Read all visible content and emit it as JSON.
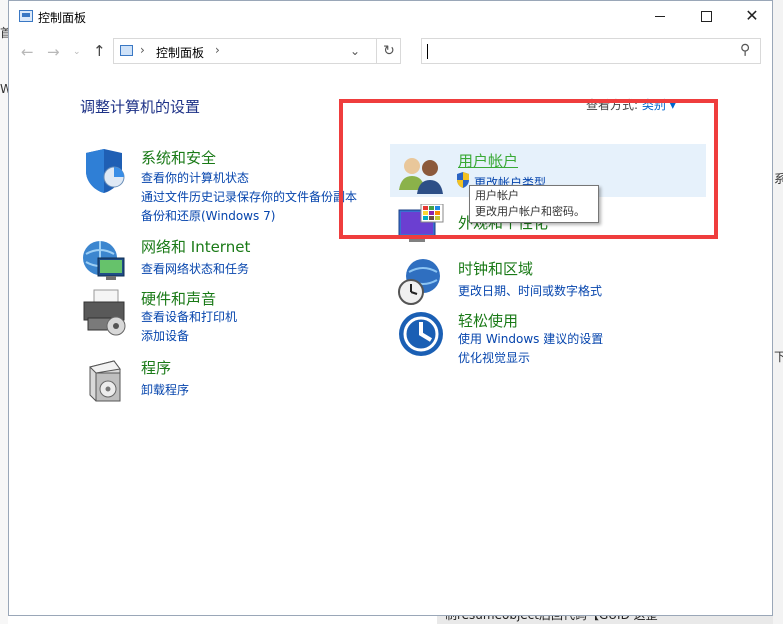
{
  "window": {
    "title": "控制面板",
    "close_glyph": "✕"
  },
  "nav": {
    "back": "←",
    "forward": "→",
    "recent": "⌄",
    "up": "↑",
    "separator": "›",
    "breadcrumb": "控制面板",
    "address_dropdown": "⌄",
    "refresh": "↻",
    "search_value": "",
    "search_glyph": "⚲"
  },
  "heading": "调整计算机的设置",
  "view_by": {
    "label": "查看方式:",
    "value": "类别",
    "arrow": "▾"
  },
  "categories": {
    "system": {
      "title": "系统和安全",
      "links": [
        "查看你的计算机状态",
        "通过文件历史记录保存你的文件备份副本",
        "备份和还原(Windows 7)"
      ]
    },
    "network": {
      "title": "网络和 Internet",
      "links": [
        "查看网络状态和任务"
      ]
    },
    "hardware": {
      "title": "硬件和声音",
      "links": [
        "查看设备和打印机",
        "添加设备"
      ]
    },
    "programs": {
      "title": "程序",
      "links": [
        "卸载程序"
      ]
    },
    "user_accounts": {
      "title": "用户帐户",
      "links": [
        "更改帐户类型"
      ]
    },
    "appearance": {
      "title": "外观和个性化",
      "links": []
    },
    "clock": {
      "title": "时钟和区域",
      "links": [
        "更改日期、时间或数字格式"
      ]
    },
    "ease": {
      "title": "轻松使用",
      "links": [
        "使用 Windows 建议的设置",
        "优化视觉显示"
      ]
    }
  },
  "tooltip": {
    "line1": "用户帐户",
    "line2": "更改用户帐户和密码。"
  },
  "background": {
    "bottom_text": "制resumeobject后回代码【GUID 这整",
    "frag_a": "W",
    "frag_b": "首",
    "frag_c": "系",
    "frag_d": "下"
  },
  "colors": {
    "accent_link": "#0645ad",
    "category_title": "#1a7a17",
    "highlight": "#ef3d3d",
    "heading": "#1e3287"
  }
}
